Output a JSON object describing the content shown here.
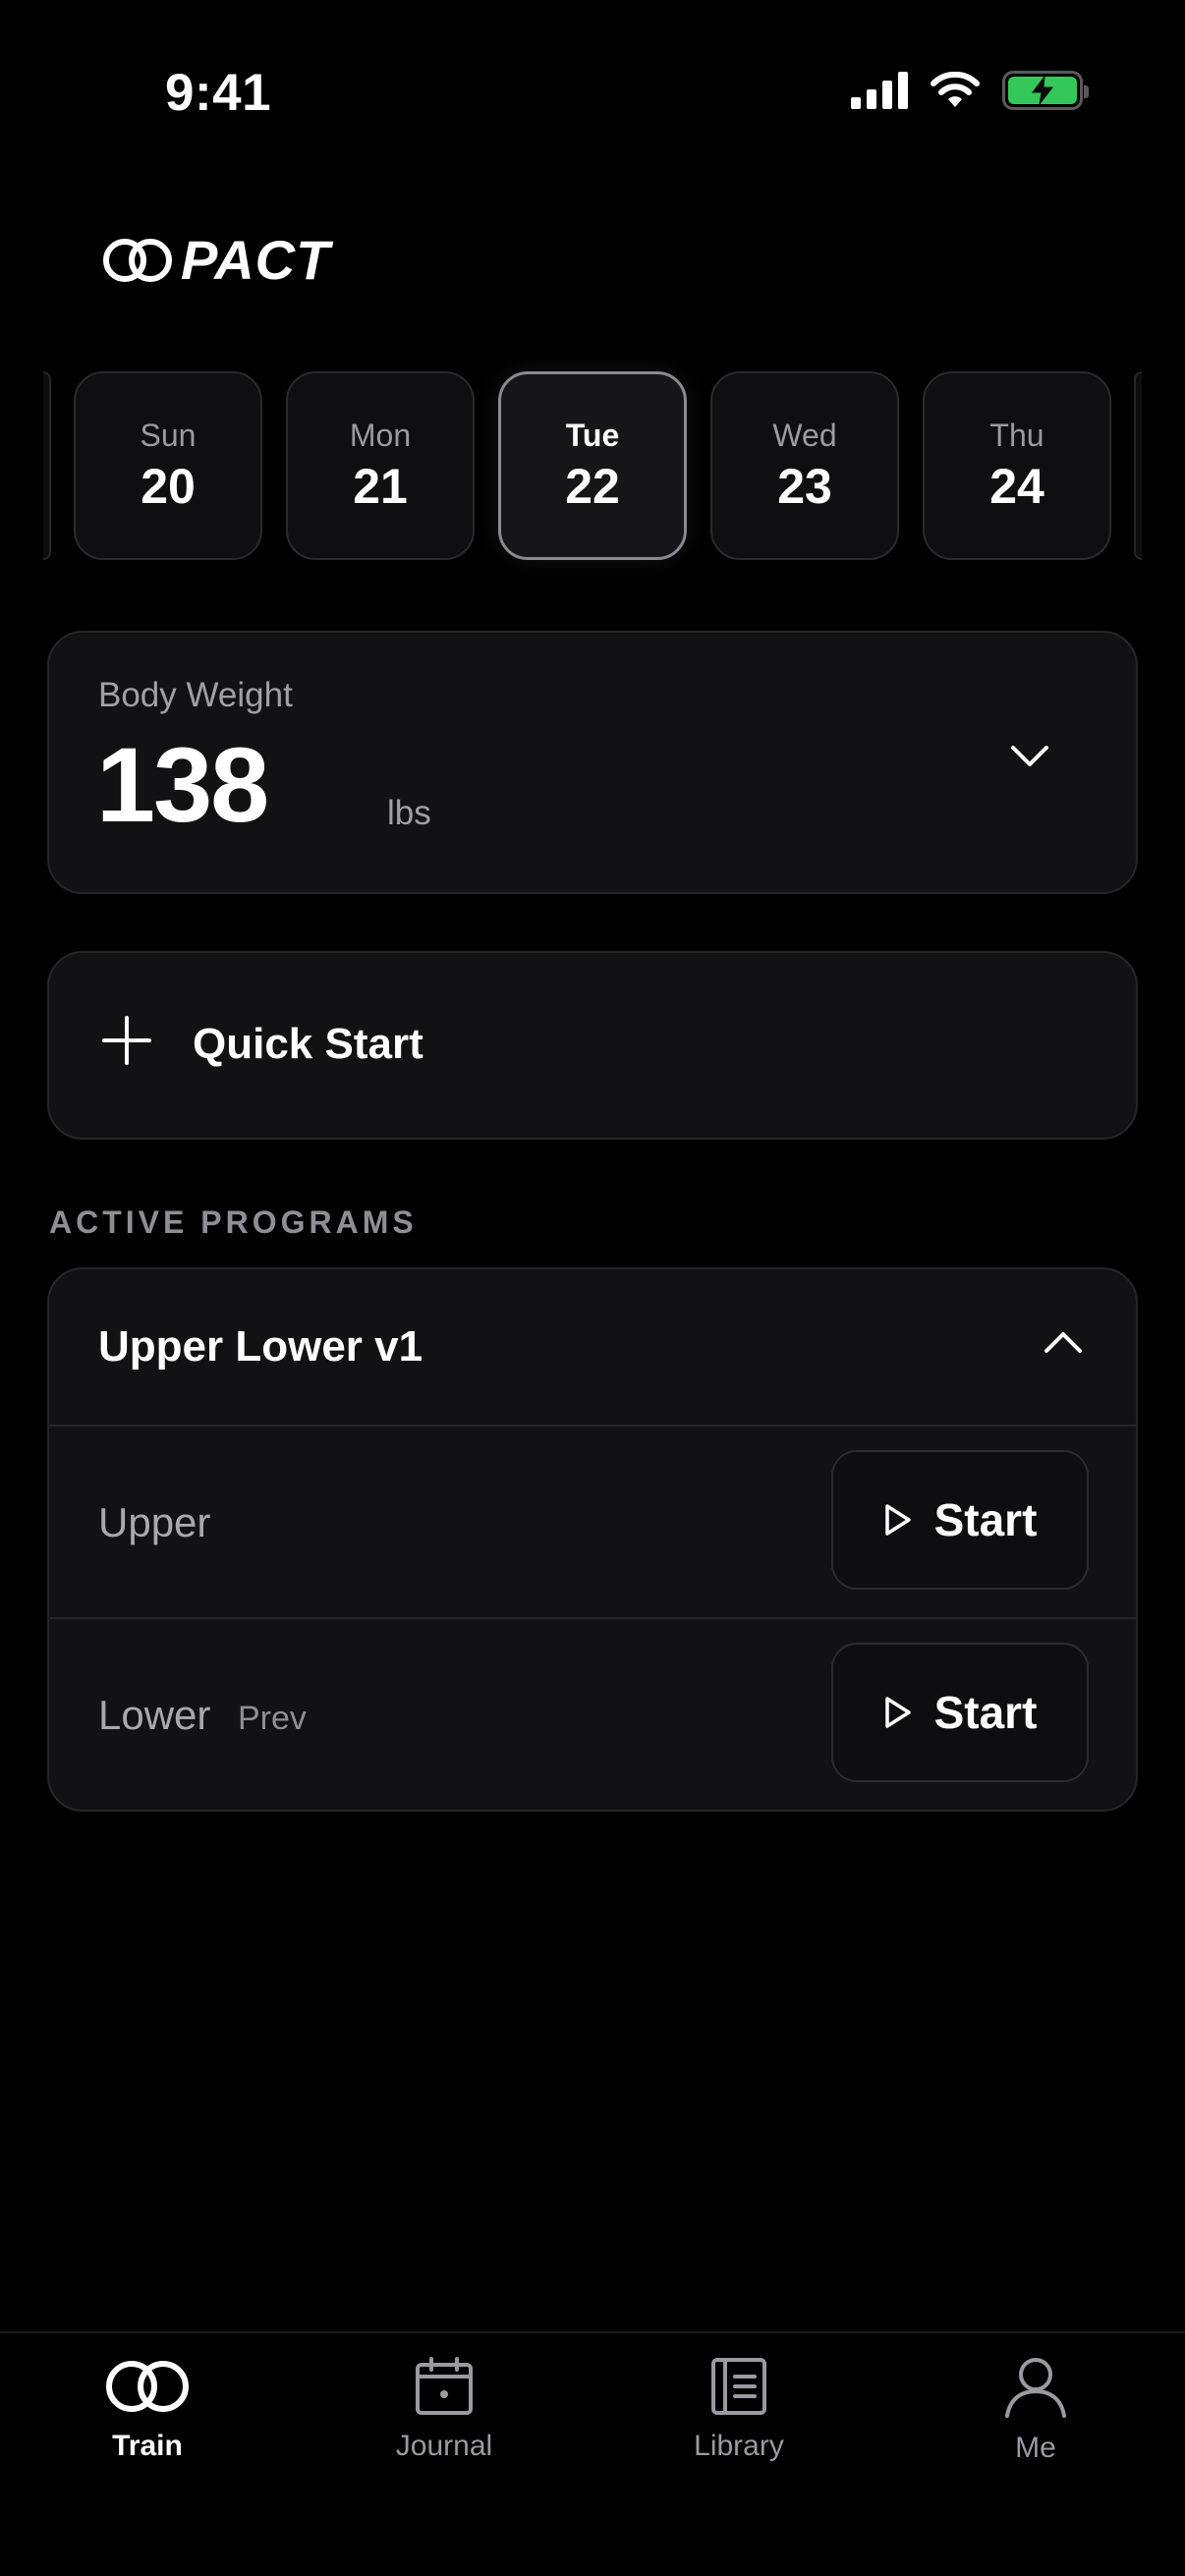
{
  "status_bar": {
    "time": "9:41"
  },
  "app": {
    "logo_text": "PACT"
  },
  "colors": {
    "accent_battery": "#34c759",
    "background": "#000000",
    "card": "#121214"
  },
  "date_strip": {
    "days": [
      {
        "name": "Sun",
        "number": "20",
        "selected": false
      },
      {
        "name": "Mon",
        "number": "21",
        "selected": false
      },
      {
        "name": "Tue",
        "number": "22",
        "selected": true
      },
      {
        "name": "Wed",
        "number": "23",
        "selected": false
      },
      {
        "name": "Thu",
        "number": "24",
        "selected": false
      }
    ]
  },
  "body_weight": {
    "label": "Body Weight",
    "value": "138",
    "unit": "lbs",
    "icon": "chevron-down-icon"
  },
  "quick_start": {
    "label": "Quick Start",
    "icon": "plus-icon"
  },
  "active_programs": {
    "section_title": "ACTIVE PROGRAMS",
    "program": {
      "title": "Upper Lower v1",
      "icon": "chevron-up-icon",
      "workouts": [
        {
          "label": "Upper",
          "sub": "",
          "button": "Start"
        },
        {
          "label": "Lower",
          "sub": "Prev",
          "button": "Start"
        }
      ]
    }
  },
  "tab_bar": {
    "tabs": [
      {
        "label": "Train",
        "icon": "rings-icon",
        "active": true
      },
      {
        "label": "Journal",
        "icon": "calendar-icon",
        "active": false
      },
      {
        "label": "Library",
        "icon": "book-icon",
        "active": false
      },
      {
        "label": "Me",
        "icon": "person-icon",
        "active": false
      }
    ]
  }
}
